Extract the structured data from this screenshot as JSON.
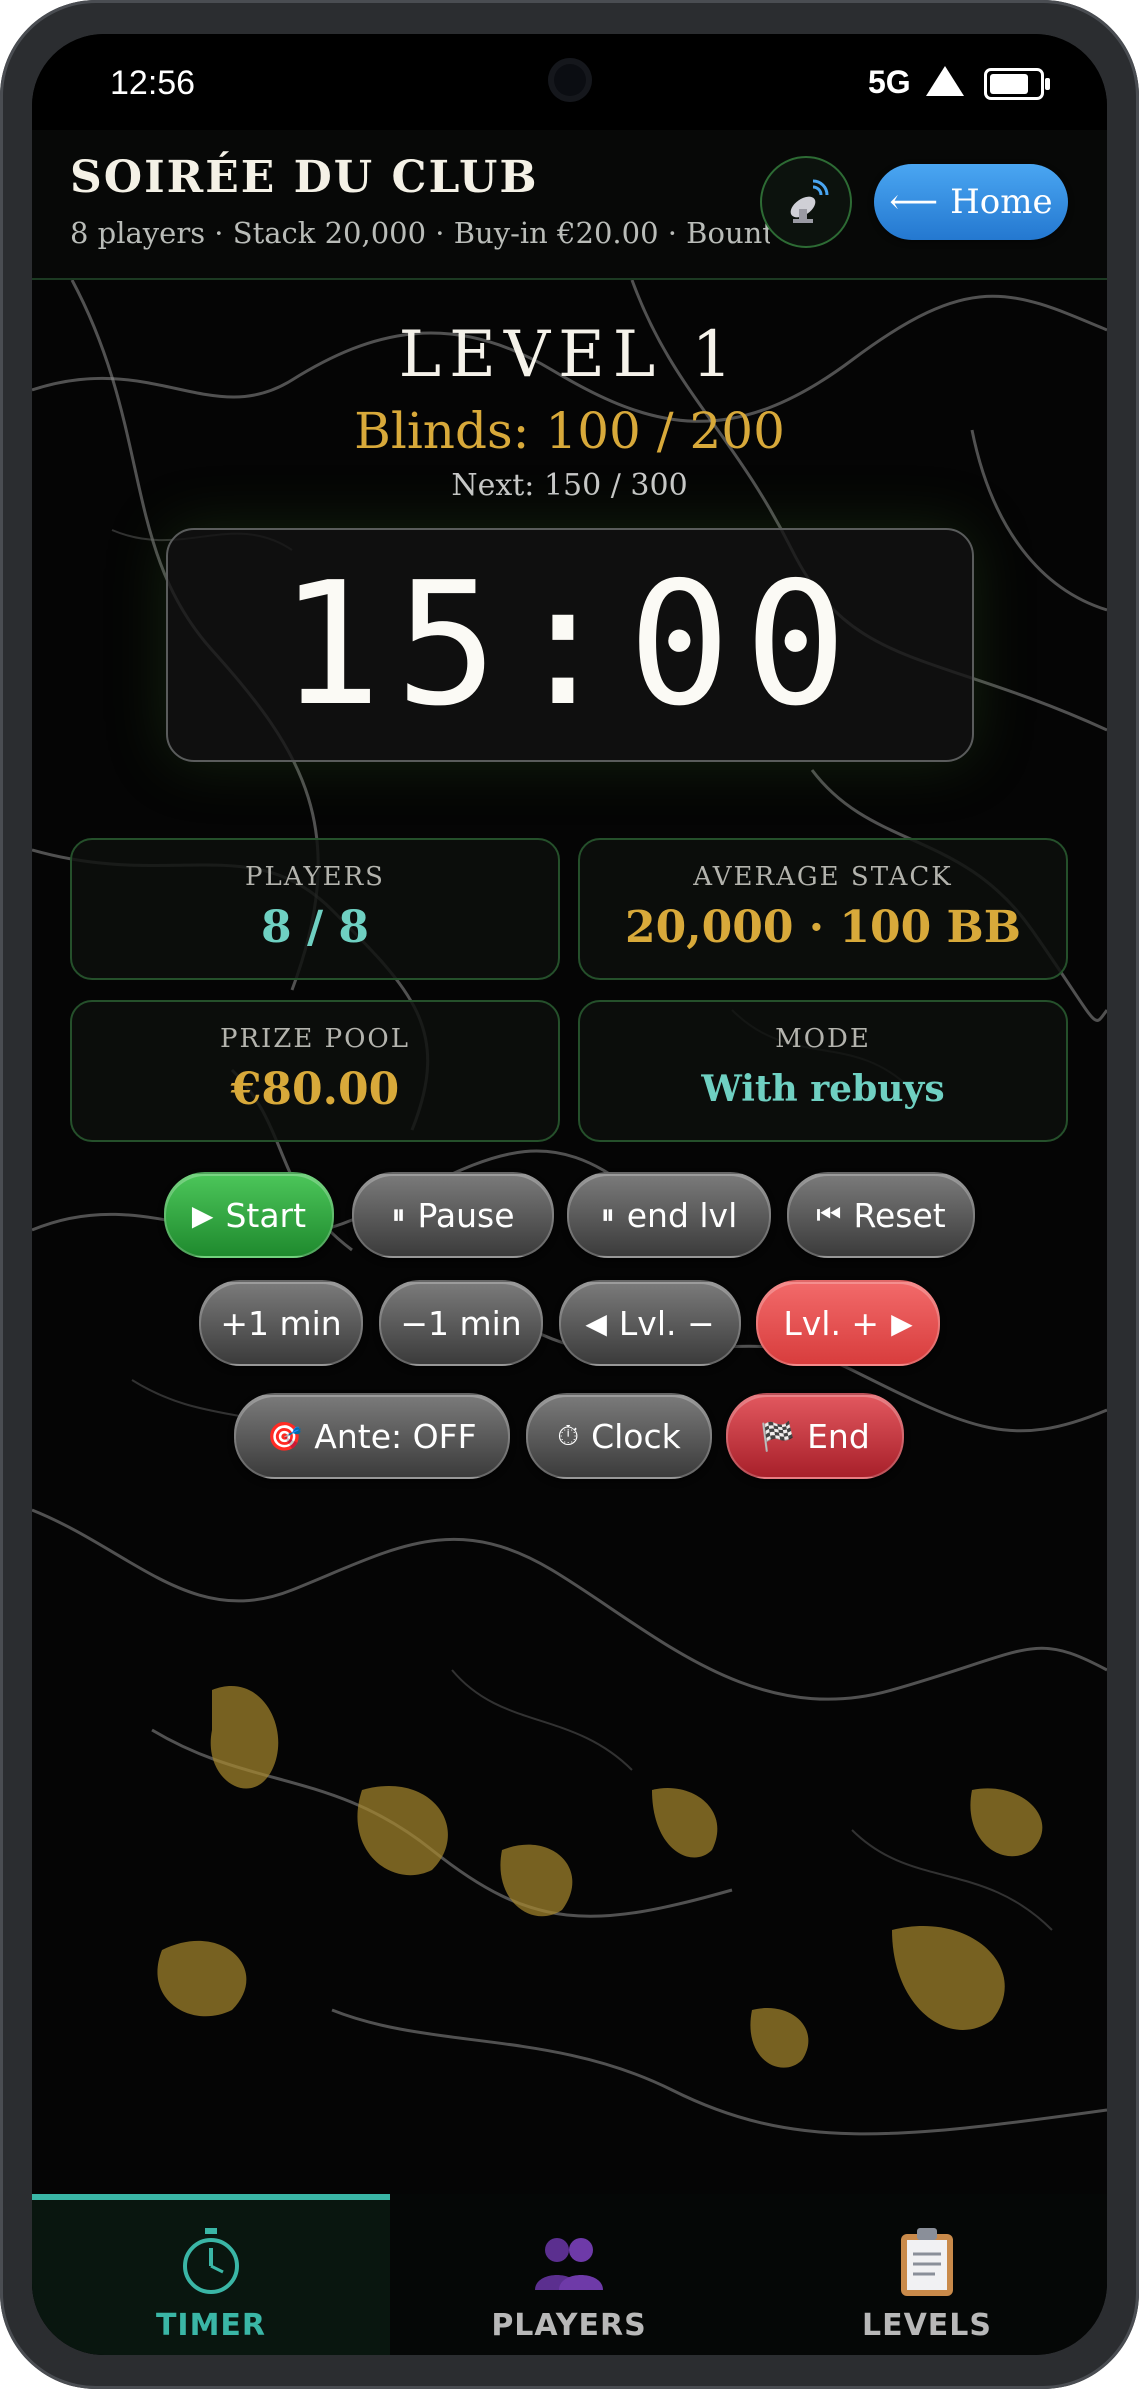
{
  "status_bar": {
    "time": "12:56",
    "network": "5G"
  },
  "header": {
    "title": "SOIRÉE DU CLUB",
    "subtitle": "8 players · Stack 20,000 · Buy-in €20.00 · Bount...",
    "home_label": "Home",
    "cast_icon": "satellite-dish-icon"
  },
  "level": {
    "label": "LEVEL 1",
    "blinds": "Blinds: 100 / 200",
    "next": "Next: 150 / 300"
  },
  "timer": {
    "display": "15:00"
  },
  "stats": {
    "players": {
      "label": "PLAYERS",
      "value": "8 / 8"
    },
    "average_stack": {
      "label": "AVERAGE STACK",
      "value": "20,000 · 100 BB"
    },
    "prize_pool": {
      "label": "PRIZE POOL",
      "value": "€80.00"
    },
    "mode": {
      "label": "MODE",
      "value": "With rebuys"
    }
  },
  "controls": {
    "start": "Start",
    "pause": "Pause",
    "end_level": "end lvl",
    "reset": "Reset",
    "plus_min": "+1 min",
    "minus_min": "−1 min",
    "level_down": "Lvl. −",
    "level_up": "Lvl. +",
    "ante": "Ante: OFF",
    "clock": "Clock",
    "end": "End"
  },
  "bottom_nav": {
    "tabs": [
      {
        "label": "TIMER",
        "icon": "stopwatch-icon",
        "active": true
      },
      {
        "label": "PLAYERS",
        "icon": "players-icon",
        "active": false
      },
      {
        "label": "LEVELS",
        "icon": "clipboard-icon",
        "active": false
      }
    ]
  },
  "colors": {
    "accent_gold": "#d8a93a",
    "accent_teal": "#6fd0c2",
    "home_blue": "#2f8de0",
    "start_green": "#2fa23c",
    "level_up_red": "#e85050"
  }
}
